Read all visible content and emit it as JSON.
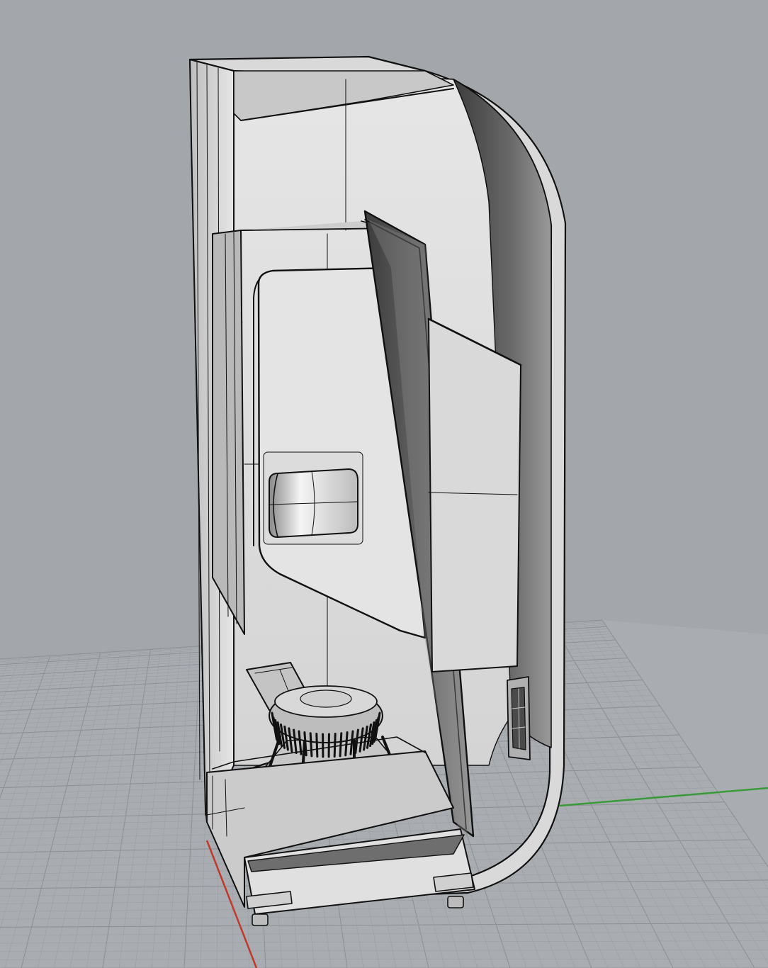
{
  "viewport": {
    "background": "#a3a6ab",
    "grid_color": "#8e9297",
    "grid_minor_color": "#979ba0",
    "axis_x_color": "#c0392b",
    "axis_y_color": "#3a9a3a"
  },
  "model": {
    "edge_color": "#111111",
    "shell_fill": "#e2e2e2",
    "inner_fill": "#cfcfcf",
    "dark_fill": "#5a5a5a",
    "panel_fill": "#d6d6d6"
  }
}
